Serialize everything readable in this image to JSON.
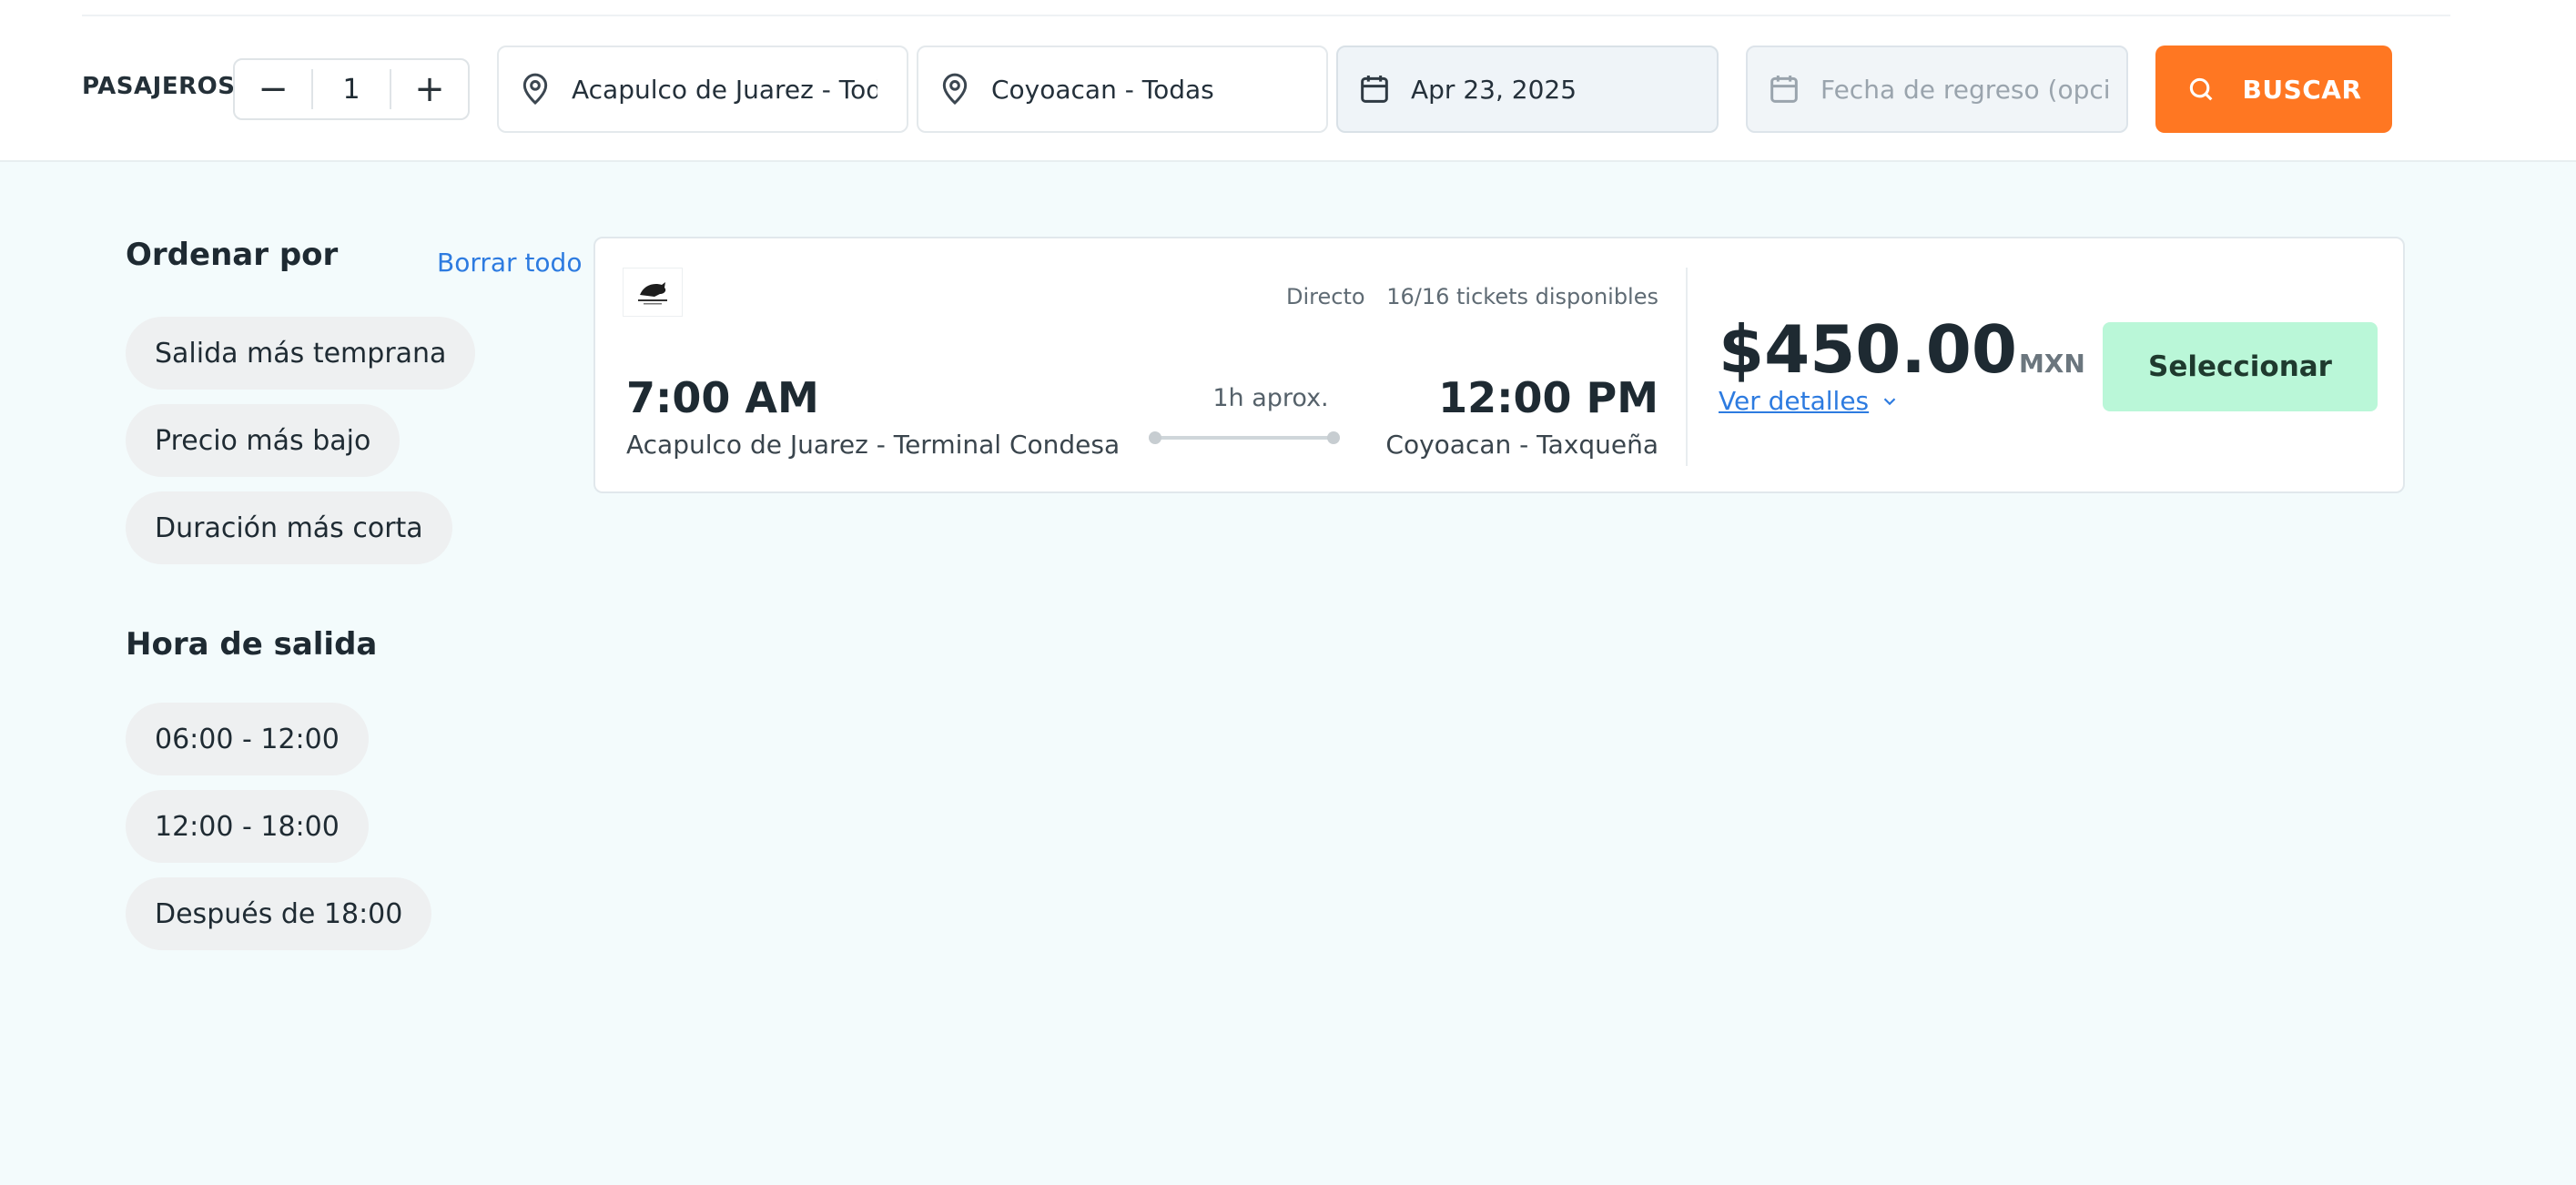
{
  "search_bar": {
    "passengers_label": "PASAJEROS",
    "passengers_count": "1",
    "decrement_symbol": "−",
    "increment_symbol": "+",
    "origin": "Acapulco de Juarez - Todas",
    "destination": "Coyoacan - Todas",
    "departure_date": "Apr 23, 2025",
    "return_date_placeholder": "Fecha de regreso (opcional)",
    "search_label": "BUSCAR",
    "accent_color": "#ff7722"
  },
  "sidebar": {
    "sort_title": "Ordenar por",
    "clear_all": "Borrar todo",
    "sort_options": [
      "Salida más temprana",
      "Precio más bajo",
      "Duración más corta"
    ],
    "time_title": "Hora de salida",
    "time_options": [
      "06:00 - 12:00",
      "12:00 - 18:00",
      "Después de 18:00"
    ]
  },
  "result": {
    "type": "Directo",
    "availability": "16/16 tickets disponibles",
    "departure_time": "7:00 AM",
    "departure_place": "Acapulco de Juarez - Terminal Condesa",
    "duration": "1h aprox.",
    "arrival_time": "12:00 PM",
    "arrival_place": "Coyoacan - Taxqueña",
    "price": "$450.00",
    "currency": "MXN",
    "details_label": "Ver detalles",
    "select_label": "Seleccionar"
  },
  "icons": {
    "location": "map-pin-icon",
    "calendar": "calendar-icon",
    "search": "search-icon",
    "chevron": "chevron-down-icon"
  }
}
